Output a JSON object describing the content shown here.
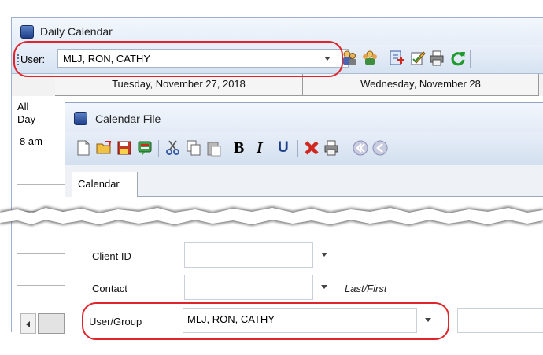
{
  "outer_window": {
    "title": "Daily Calendar",
    "user_label": "User:",
    "user_value": "MLJ, RON, CATHY",
    "day_headers": [
      "Tuesday, November 27, 2018",
      "Wednesday, November 28"
    ],
    "all_day": [
      "All",
      "Day"
    ],
    "time_label": "8 am"
  },
  "inner_window": {
    "title": "Calendar File",
    "tabs": [
      "Calendar"
    ],
    "fields": {
      "client_id_label": "Client ID",
      "contact_label": "Contact",
      "contact_hint": "Last/First",
      "user_group_label": "User/Group",
      "user_group_value": "MLJ, RON, CATHY"
    },
    "format_buttons": {
      "bold": "B",
      "italic": "I",
      "underline": "U"
    }
  },
  "colors": {
    "highlight": "#e0242b",
    "title_bar": "#e5edf8",
    "toolbar": "#d6e2f2"
  }
}
